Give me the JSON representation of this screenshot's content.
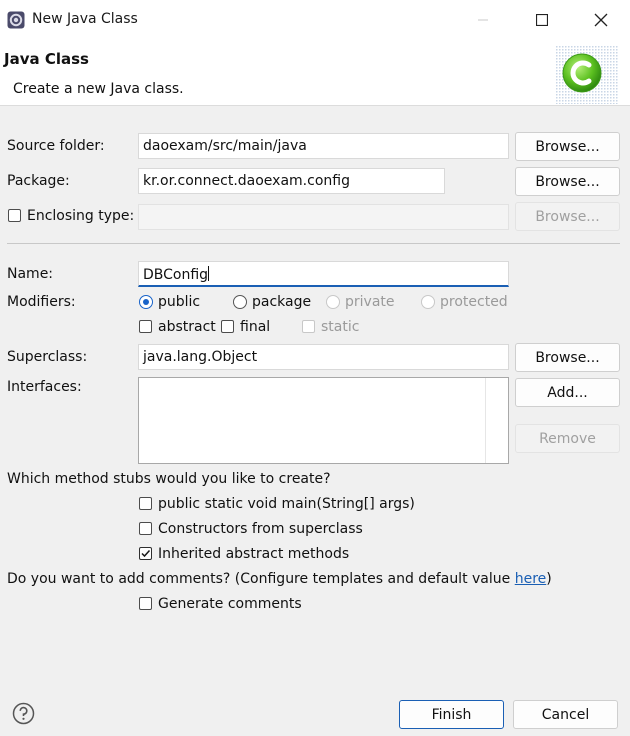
{
  "window": {
    "title": "New Java Class"
  },
  "header": {
    "title": "Java Class",
    "description": "Create a new Java class."
  },
  "source_folder": {
    "label": "Source folder:",
    "value": "daoexam/src/main/java",
    "browse_label": "Browse..."
  },
  "package": {
    "label": "Package:",
    "value": "kr.or.connect.daoexam.config",
    "browse_label": "Browse..."
  },
  "enclosing_type": {
    "label": "Enclosing type:",
    "value": "",
    "browse_label": "Browse...",
    "checked": false
  },
  "name": {
    "label": "Name:",
    "value": "DBConfig"
  },
  "modifiers": {
    "label": "Modifiers:",
    "options": [
      "public",
      "package",
      "private",
      "protected"
    ],
    "selected": "public",
    "extra": [
      "abstract",
      "final",
      "static"
    ]
  },
  "superclass": {
    "label": "Superclass:",
    "value": "java.lang.Object",
    "browse_label": "Browse..."
  },
  "interfaces": {
    "label": "Interfaces:",
    "add_label": "Add...",
    "remove_label": "Remove"
  },
  "stubs": {
    "question": "Which method stubs would you like to create?",
    "items": [
      {
        "label": "public static void main(String[] args)",
        "checked": false
      },
      {
        "label": "Constructors from superclass",
        "checked": false
      },
      {
        "label": "Inherited abstract methods",
        "checked": true
      }
    ]
  },
  "comments": {
    "question": "Do you want to add comments? (Configure templates and default value ",
    "link": "here",
    "question_end": ")",
    "generate_label": "Generate comments"
  },
  "footer": {
    "finish_label": "Finish",
    "cancel_label": "Cancel"
  },
  "colors": {
    "accent": "#1863c9",
    "focus_underline": "#1a5fb4",
    "badge_green": "#5cc020"
  },
  "icons": [
    "eclipse-app-icon",
    "minimize-icon",
    "maximize-icon",
    "close-icon",
    "new-class-badge-icon",
    "help-icon"
  ]
}
